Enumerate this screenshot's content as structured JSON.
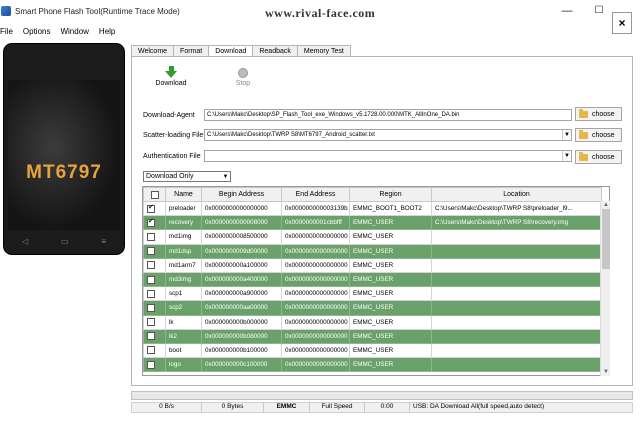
{
  "window": {
    "title": "Smart Phone Flash Tool(Runtime Trace Mode)",
    "watermark": "www.rival-face.com",
    "minimize": "—",
    "maximize": "☐",
    "close": "×"
  },
  "menu": [
    "File",
    "Options",
    "Window",
    "Help"
  ],
  "phone": {
    "chip": "MT6797"
  },
  "tabs": [
    "Welcome",
    "Format",
    "Download",
    "Readback",
    "Memory Test"
  ],
  "active_tab": "Download",
  "toolbar": {
    "download_label": "Download",
    "stop_label": "Stop"
  },
  "fields": {
    "download_agent_label": "Download-Agent",
    "download_agent_value": "C:\\Users\\Makc\\Desktop\\SP_Flash_Tool_exe_Windows_v5.1728.00.000\\MTK_AllInOne_DA.bin",
    "scatter_label": "Scatter-loading File",
    "scatter_value": "C:\\Users\\Makc\\Desktop\\TWRP S8\\MT6797_Android_scatter.txt",
    "auth_label": "Authentication File",
    "auth_value": "",
    "choose_label": "choose"
  },
  "mode": "Download Only",
  "table": {
    "headers": [
      "",
      "Name",
      "Begin Address",
      "End Address",
      "Region",
      "Location"
    ],
    "rows": [
      {
        "checked": true,
        "name": "preloader",
        "begin": "0x0000000000000000",
        "end": "0x000000000003139b",
        "region": "EMMC_BOOT1_BOOT2",
        "location": "C:\\Users\\Makc\\Desktop\\TWRP S8\\preloader_l9..."
      },
      {
        "checked": true,
        "name": "recovery",
        "begin": "0x0000000000008000",
        "end": "0x0000000001cbbfff",
        "region": "EMMC_USER",
        "location": "C:\\Users\\Makc\\Desktop\\TWRP S8\\recovery.img"
      },
      {
        "checked": false,
        "name": "md1img",
        "begin": "0x0000000008500000",
        "end": "0x0000000000000000",
        "region": "EMMC_USER",
        "location": ""
      },
      {
        "checked": false,
        "name": "md1dsp",
        "begin": "0x0000000009d00000",
        "end": "0x0000000000000000",
        "region": "EMMC_USER",
        "location": ""
      },
      {
        "checked": false,
        "name": "md1arm7",
        "begin": "0x000000000a100000",
        "end": "0x0000000000000000",
        "region": "EMMC_USER",
        "location": ""
      },
      {
        "checked": false,
        "name": "md3img",
        "begin": "0x000000000a400000",
        "end": "0x0000000000000000",
        "region": "EMMC_USER",
        "location": ""
      },
      {
        "checked": false,
        "name": "scp1",
        "begin": "0x000000000a900000",
        "end": "0x0000000000000000",
        "region": "EMMC_USER",
        "location": ""
      },
      {
        "checked": false,
        "name": "scp2",
        "begin": "0x000000000aa00000",
        "end": "0x0000000000000000",
        "region": "EMMC_USER",
        "location": ""
      },
      {
        "checked": false,
        "name": "lk",
        "begin": "0x000000000b000000",
        "end": "0x0000000000000000",
        "region": "EMMC_USER",
        "location": ""
      },
      {
        "checked": false,
        "name": "lk2",
        "begin": "0x000000000b080000",
        "end": "0x0000000000000000",
        "region": "EMMC_USER",
        "location": ""
      },
      {
        "checked": false,
        "name": "boot",
        "begin": "0x000000000b100000",
        "end": "0x0000000000000000",
        "region": "EMMC_USER",
        "location": ""
      },
      {
        "checked": false,
        "name": "logo",
        "begin": "0x000000000c100000",
        "end": "0x0000000000000000",
        "region": "EMMC_USER",
        "location": ""
      }
    ]
  },
  "status": {
    "speed": "0 B/s",
    "bytes": "0 Bytes",
    "storage": "EMMC",
    "mode": "Full Speed",
    "time": "0:00",
    "usb": "USB: DA Download All(full speed,auto detect)"
  },
  "colors": {
    "shade_row": "#6aa06a",
    "chip_text": "#e8a33a",
    "download_icon": "#2f9e2f"
  }
}
